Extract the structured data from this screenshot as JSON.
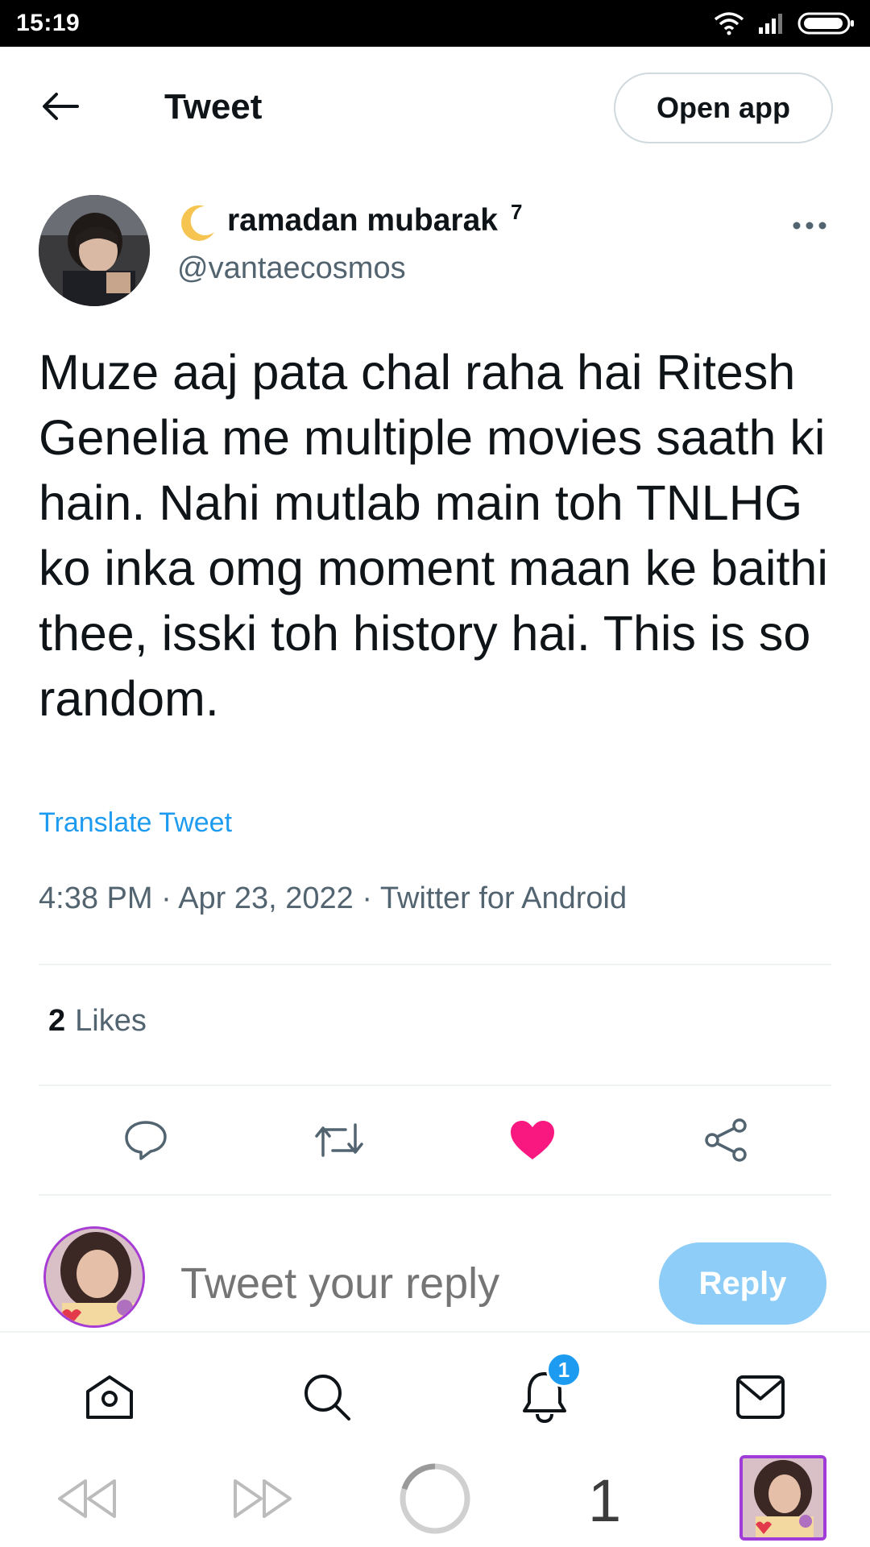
{
  "status_bar": {
    "time": "15:19",
    "icons": [
      "wifi-icon",
      "signal-icon",
      "battery-icon"
    ]
  },
  "header": {
    "title": "Tweet",
    "open_app_label": "Open app",
    "back_icon": "arrow-left-icon"
  },
  "author": {
    "display_name": "ramadan mubarak",
    "name_emoji": "crescent-moon-icon",
    "superscript": "7",
    "handle": "@vantaecosmos"
  },
  "tweet": {
    "text": "Muze aaj pata chal raha hai Ritesh Genelia me multiple movies saath ki hain. Nahi mutlab main toh TNLHG ko inka omg moment maan ke baithi thee, isski toh history hai. This is so random.",
    "translate_label": "Translate Tweet",
    "meta": "4:38 PM · Apr 23, 2022 · Twitter for Android"
  },
  "engagement": {
    "likes_count": "2",
    "likes_label": "Likes"
  },
  "actions": [
    "reply-icon",
    "retweet-icon",
    "like-icon",
    "share-icon"
  ],
  "reply_box": {
    "placeholder": "Tweet your reply",
    "button_label": "Reply"
  },
  "bottom_nav": {
    "items": [
      "home-icon",
      "search-icon",
      "notifications-icon",
      "messages-icon"
    ],
    "notification_badge": "1"
  },
  "browser_bar": {
    "tab_count": "1"
  },
  "colors": {
    "accent": "#1d9bf0",
    "like": "#f91880",
    "reply_button_disabled": "#8ecdf8",
    "secondary_text": "#536471"
  }
}
